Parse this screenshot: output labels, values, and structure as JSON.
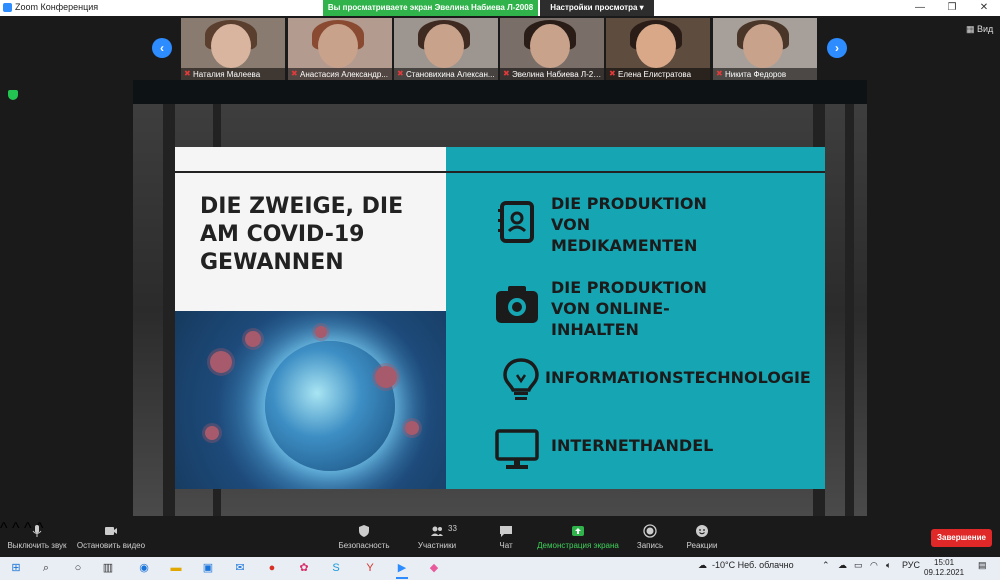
{
  "window": {
    "title": "Zoom Конференция",
    "share_banner": "Вы просматриваете экран Эвелина Набиева Л-2008",
    "view_settings": "Настройки просмотра",
    "view_mode": "Вид"
  },
  "participants": [
    {
      "name": "Наталия Малеева"
    },
    {
      "name": "Анастасия Александр..."
    },
    {
      "name": "Становихина Алексан..."
    },
    {
      "name": "Эвелина Набиева Л-2008"
    },
    {
      "name": "Елена Елистратова"
    },
    {
      "name": "Никита Федоров"
    }
  ],
  "slide": {
    "title": "DIE ZWEIGE, DIE AM COVID-19 GEWANNEN",
    "items": [
      {
        "icon": "notebook-icon",
        "label_lines": [
          "DIE PRODUKTION",
          "VON",
          "MEDIKAMENTEN"
        ]
      },
      {
        "icon": "camera-icon",
        "label_lines": [
          "DIE PRODUKTION",
          "VON ONLINE-",
          "INHALTEN"
        ]
      },
      {
        "icon": "lightbulb-icon",
        "label_lines": [
          "INFORMATIONSTECHNOLOGIE"
        ]
      },
      {
        "icon": "monitor-icon",
        "label_lines": [
          "INTERNETHANDEL"
        ]
      }
    ]
  },
  "controls": {
    "mute": "Выключить звук",
    "video": "Остановить видео",
    "security": "Безопасность",
    "participants": "Участники",
    "participants_count": "33",
    "chat": "Чат",
    "share": "Демонстрация экрана",
    "record": "Запись",
    "reactions": "Реакции",
    "end": "Завершение"
  },
  "taskbar": {
    "weather": "-10°C  Неб. облачно",
    "language": "РУС",
    "time": "15:01",
    "date": "09.12.2021"
  },
  "colors": {
    "teal": "#16a6b3",
    "zoom_blue": "#2d8cff",
    "banner_green": "#2fb34a",
    "end_red": "#e02828"
  }
}
